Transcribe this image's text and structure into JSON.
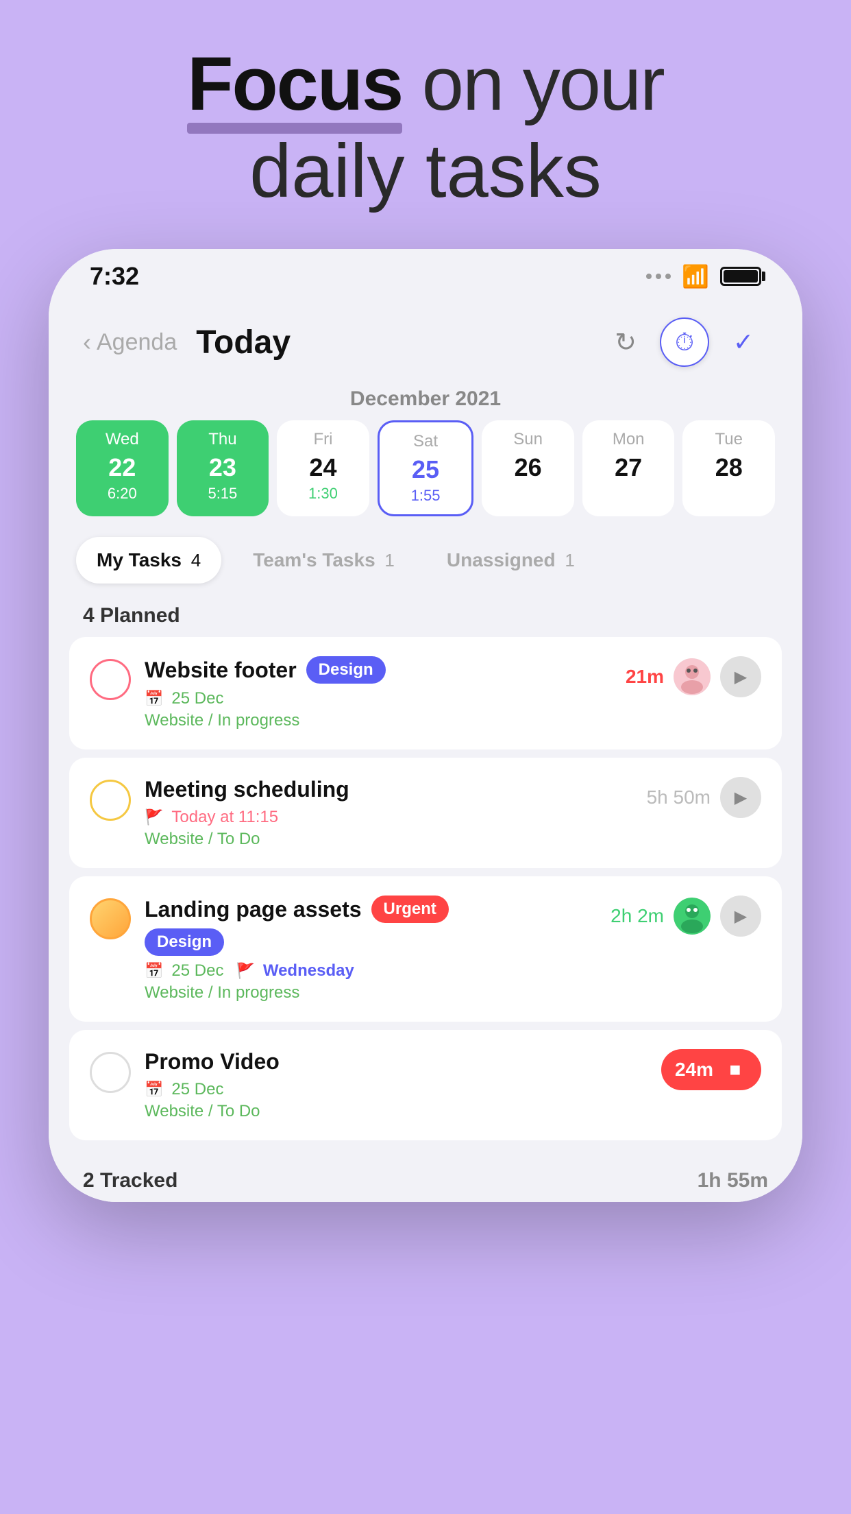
{
  "header": {
    "line1_bold": "Focus",
    "line1_rest": " on your",
    "line2": "daily tasks"
  },
  "status_bar": {
    "time": "7:32"
  },
  "nav": {
    "back_label": "Agenda",
    "title": "Today"
  },
  "calendar": {
    "month": "December 2021",
    "days": [
      {
        "name": "Wed",
        "num": "22",
        "time": "6:20",
        "style": "green"
      },
      {
        "name": "Thu",
        "num": "23",
        "time": "5:15",
        "style": "green"
      },
      {
        "name": "Fri",
        "num": "24",
        "time": "1:30",
        "style": "light-green"
      },
      {
        "name": "Sat",
        "num": "25",
        "time": "1:55",
        "style": "selected"
      },
      {
        "name": "Sun",
        "num": "26",
        "time": "",
        "style": "empty"
      },
      {
        "name": "Mon",
        "num": "27",
        "time": "",
        "style": "empty"
      },
      {
        "name": "Tue",
        "num": "28",
        "time": "",
        "style": "empty"
      }
    ]
  },
  "tabs": [
    {
      "label": "My Tasks",
      "count": "4",
      "active": true
    },
    {
      "label": "Team's Tasks",
      "count": "1",
      "active": false
    },
    {
      "label": "Unassigned",
      "count": "1",
      "active": false
    }
  ],
  "planned_section": {
    "header": "4 Planned",
    "tasks": [
      {
        "title": "Website footer",
        "badge": "Design",
        "badge_type": "design",
        "checkbox": "pink",
        "time": "21m",
        "time_color": "red",
        "meta_icon": "calendar",
        "meta_date": "25 Dec",
        "meta_status": "Website / In progress",
        "has_avatar": true,
        "has_play": true
      },
      {
        "title": "Meeting scheduling",
        "badge": "",
        "badge_type": "",
        "checkbox": "empty",
        "time": "5h 50m",
        "time_color": "gray",
        "meta_icon": "flag",
        "meta_date": "Today at 11:15",
        "meta_status": "Website / To Do",
        "has_avatar": false,
        "has_play": true
      },
      {
        "title": "Landing page assets",
        "badge": "Urgent",
        "badge_type": "urgent",
        "badge2": "Design",
        "badge2_type": "design",
        "checkbox": "orange",
        "time": "2h 2m",
        "time_color": "teal",
        "meta_icon": "calendar",
        "meta_date": "25 Dec",
        "meta_flag": "Wednesday",
        "meta_status": "Website / In progress",
        "has_avatar": true,
        "has_play": true
      },
      {
        "title": "Promo Video",
        "badge": "",
        "badge_type": "",
        "checkbox": "empty",
        "time": "24m",
        "time_color": "timer-red",
        "meta_icon": "calendar",
        "meta_date": "25 Dec",
        "meta_status": "Website / To Do",
        "has_avatar": false,
        "has_play": false,
        "is_tracking": true
      }
    ]
  },
  "tracked_section": {
    "header": "2 Tracked",
    "total_time": "1h 55m"
  }
}
